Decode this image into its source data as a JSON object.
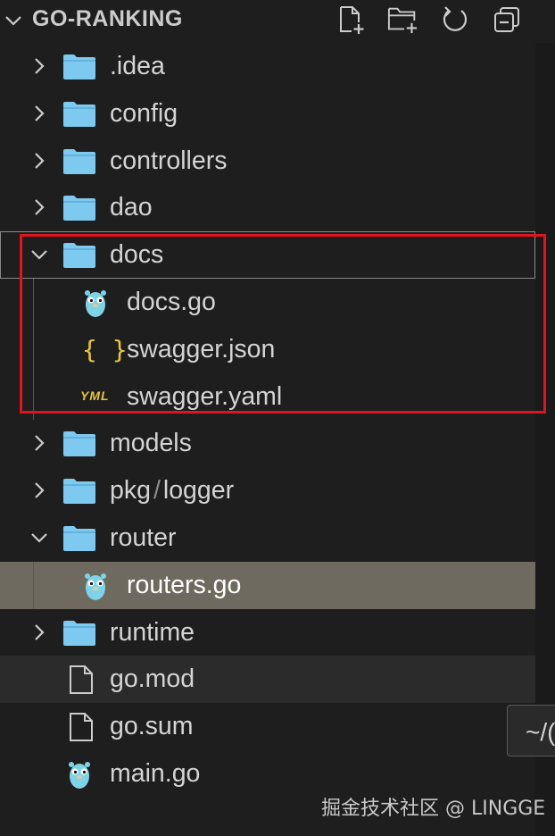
{
  "explorer": {
    "title": "GO-RANKING",
    "actions": [
      "new-file-icon",
      "new-folder-icon",
      "refresh-icon",
      "collapse-all-icon"
    ]
  },
  "tree": {
    "idea": ".idea",
    "config": "config",
    "controllers": "controllers",
    "dao": "dao",
    "docs": "docs",
    "docs_go": "docs.go",
    "swagger_json": "swagger.json",
    "swagger_yaml": "swagger.yaml",
    "models": "models",
    "pkg": "pkg",
    "pkg_sep": "/",
    "logger": "logger",
    "router": "router",
    "routers_go": "routers.go",
    "runtime": "runtime",
    "go_mod": "go.mod",
    "go_sum": "go.sum",
    "main_go": "main.go"
  },
  "json_icon_text": "{ }",
  "yaml_icon_text": "YML",
  "tooltip": {
    "text": "~/("
  },
  "watermark": "掘金技术社区 @ LINGGE",
  "colors": {
    "folder": "#7ec9f0",
    "selection": "#6f6a5f",
    "highlight_box": "#e0141f",
    "json_icon": "#e8c53b"
  }
}
